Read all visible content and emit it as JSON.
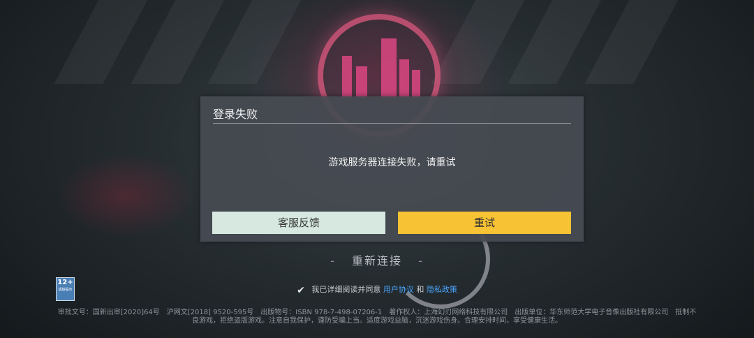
{
  "dialog": {
    "title": "登录失败",
    "message": "游戏服务器连接失败，请重试",
    "feedback_button": "客服反馈",
    "retry_button": "重试"
  },
  "reconnect": {
    "dash_left": "-",
    "label": "重新连接",
    "dash_right": "-"
  },
  "age_rating": {
    "value": "12+",
    "caption": "适龄提示"
  },
  "agreement": {
    "prefix": "我已详细阅读并同意",
    "user_agreement": "用户协议",
    "and": "和",
    "privacy_policy": "隐私政策"
  },
  "legal": {
    "line1": "审批文号：国新出审[2020]64号　沪网文[2018] 9520-595号　出版物号：ISBN 978-7-498-07206-1　著作权人：上海幻刃网络科技有限公司　出版单位：华东师范大学电子音像出版社有限公司　抵制不良游戏，拒绝盗版游戏。注意自我保护，谨防受骗上当。适度游戏益脑，沉迷游戏伤身。合理安排时间，享受健康生活。"
  },
  "colors": {
    "retry_button": "#f7c233",
    "feedback_button": "#d6e8e0",
    "link": "#4aa6ff",
    "dialog_bg": "#464a52"
  }
}
